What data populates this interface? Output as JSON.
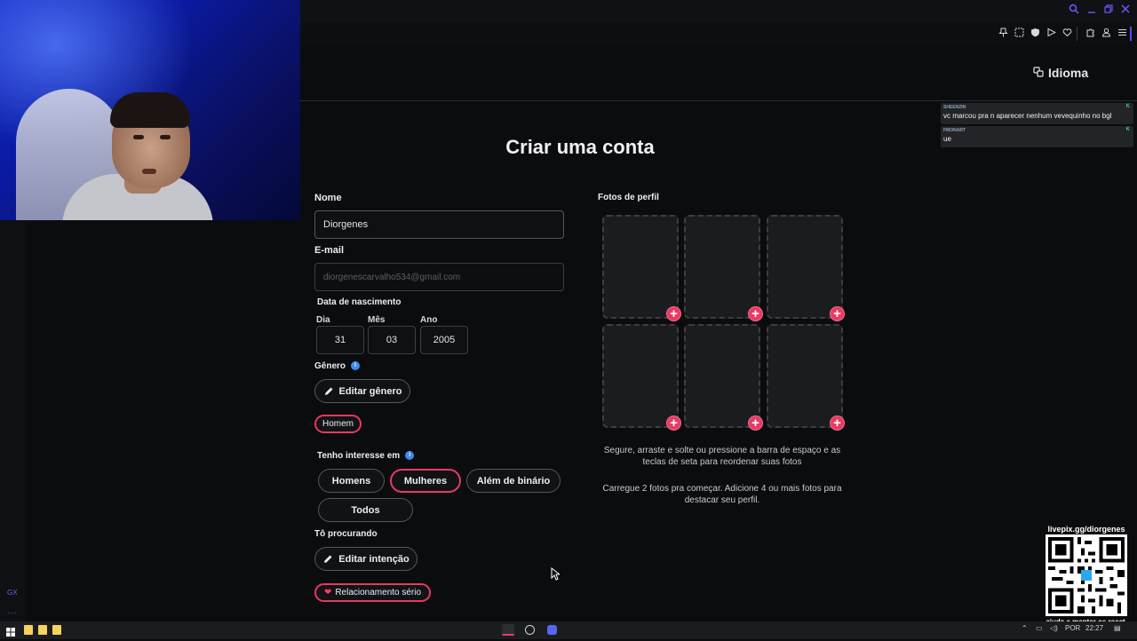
{
  "site": {
    "language_button": "Idioma",
    "page_title": "Criar uma conta"
  },
  "form": {
    "name_label": "Nome",
    "name_value": "Diorgenes",
    "email_label": "E-mail",
    "email_value": "diorgenescarvalho534@gmail.com",
    "birth_label": "Data de nascimento",
    "day_label": "Dia",
    "month_label": "Mês",
    "year_label": "Ano",
    "day_value": "31",
    "month_value": "03",
    "year_value": "2005",
    "gender_label": "Gênero",
    "edit_gender_button": "Editar gênero",
    "gender_tag": "Homem",
    "interest_label": "Tenho interesse em",
    "interest_options": [
      "Homens",
      "Mulheres",
      "Além de binário",
      "Todos"
    ],
    "interest_selected": "Mulheres",
    "looking_label": "Tô procurando",
    "edit_intention_button": "Editar intenção",
    "intention_tag": "Relacionamento sério"
  },
  "photos": {
    "label": "Fotos de perfil",
    "slot_count": 6,
    "hint_reorder": "Segure, arraste e solte ou pressione a barra de espaço e as teclas de seta para reordenar suas fotos",
    "hint_upload": "Carregue 2 fotos pra começar. Adicione 4 ou mais fotos para destacar seu perfil."
  },
  "chat": [
    {
      "user": "SHEENZIN",
      "text": "vc marcou pra n aparecer nenhum vevequinho no bgl"
    },
    {
      "user": "FMONART",
      "text": "ue"
    }
  ],
  "overlay": {
    "qr_url": "livepix.gg/diorgenes",
    "qr_caption": "ajude a manter os react",
    "side_label": "GX",
    "side_dots": "..."
  },
  "taskbar": {
    "language": "POR",
    "time": "22:27"
  },
  "colors": {
    "accent": "#e83a63",
    "background": "#0b0c0e",
    "browser_accent": "#6a5cff",
    "info": "#3d8bf0"
  }
}
